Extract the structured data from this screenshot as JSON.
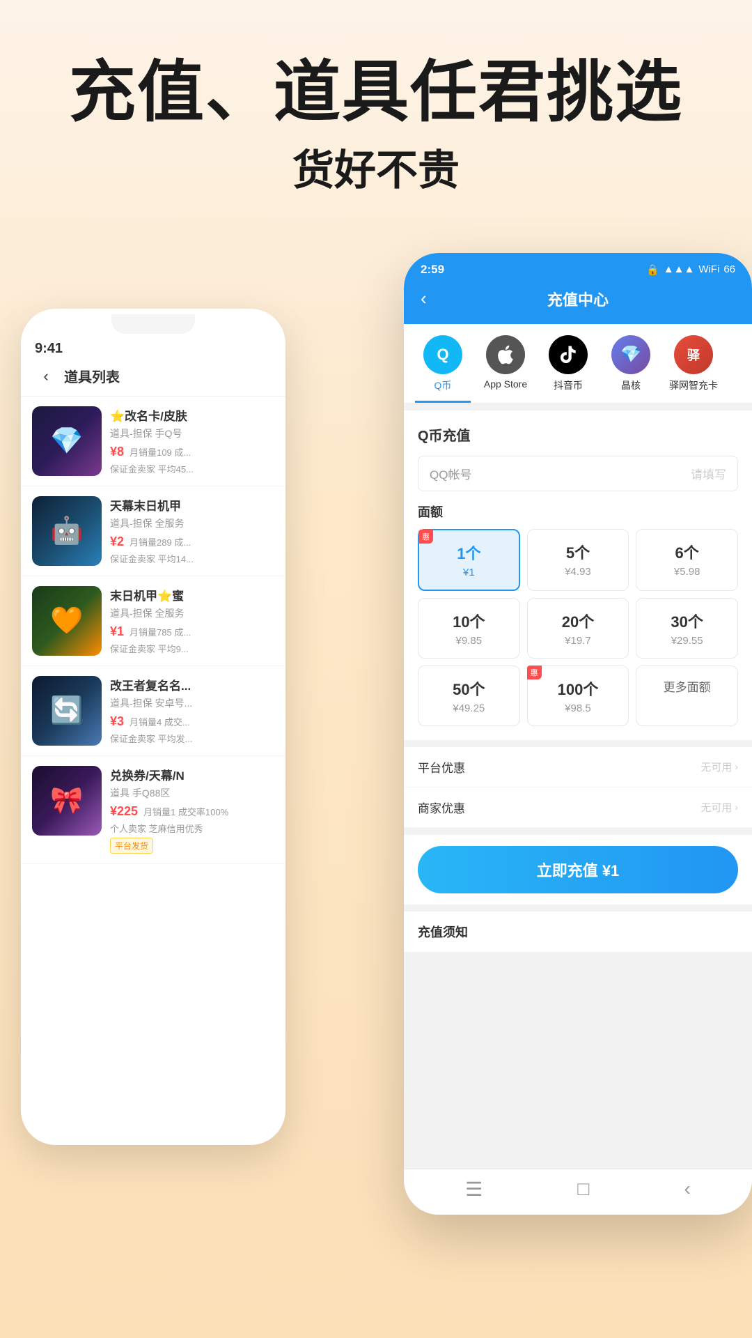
{
  "hero": {
    "title": "充值、道具任君挑选",
    "subtitle": "货好不贵"
  },
  "left_phone": {
    "time": "9:41",
    "back_label": "‹",
    "page_title": "道具列表",
    "items": [
      {
        "id": 1,
        "name": "⭐改名卡/皮肤",
        "desc": "道具-担保 手Q号",
        "price": "¥8",
        "sales": "月销量109 成...",
        "guarantee": "保证金卖家 平均45...",
        "img_class": "img-item1",
        "icon": "💎"
      },
      {
        "id": 2,
        "name": "天幕末日机甲",
        "desc": "道具-担保 全服务",
        "price": "¥2",
        "sales": "月销量289 成...",
        "guarantee": "保证金卖家 平均14...",
        "img_class": "img-item2",
        "icon": "🤖"
      },
      {
        "id": 3,
        "name": "末日机甲⭐蜜",
        "desc": "道具-担保 全服务",
        "price": "¥1",
        "sales": "月销量785 成...",
        "guarantee": "保证金卖家 平均9...",
        "img_class": "img-item3",
        "icon": "🧡"
      },
      {
        "id": 4,
        "name": "改王者复名名...",
        "desc": "道具-担保 安卓号...",
        "price": "¥3",
        "sales": "月销量4 成交...",
        "guarantee": "保证金卖家 平均发...",
        "img_class": "img-item4",
        "icon": "🔄"
      },
      {
        "id": 5,
        "name": "兑换券/天幕/N",
        "desc": "道具 手Q88区",
        "price": "¥225",
        "sales": "月销量1 成交率100%",
        "guarantee": "个人卖家 芝麻信用优秀",
        "img_class": "img-item5",
        "icon": "🎀",
        "tag": "平台发货"
      }
    ]
  },
  "right_phone": {
    "time": "2:59",
    "back_label": "‹",
    "page_title": "充值中心",
    "categories": [
      {
        "id": "qq",
        "label": "Q币",
        "icon": "Q",
        "bg": "qq",
        "active": true
      },
      {
        "id": "appstore",
        "label": "App Store",
        "icon": "",
        "bg": "apple",
        "active": false
      },
      {
        "id": "tiktok",
        "label": "抖音币",
        "icon": "♪",
        "bg": "tiktok",
        "active": false
      },
      {
        "id": "crystal",
        "label": "晶核",
        "icon": "✦",
        "bg": "crystal",
        "active": false
      },
      {
        "id": "junka",
        "label": "驿网智充卡",
        "icon": "驿",
        "bg": "junka",
        "active": false
      }
    ],
    "recharge_title": "Q币充值",
    "qq_account_label": "QQ帐号",
    "qq_account_placeholder": "请填写",
    "denom_title": "面额",
    "denominations": [
      {
        "count": "1个",
        "price": "¥1",
        "selected": true,
        "hui": true
      },
      {
        "count": "5个",
        "price": "¥4.93",
        "selected": false,
        "hui": false
      },
      {
        "count": "6个",
        "price": "¥5.98",
        "selected": false,
        "hui": false
      },
      {
        "count": "10个",
        "price": "¥9.85",
        "selected": false,
        "hui": false
      },
      {
        "count": "20个",
        "price": "¥19.7",
        "selected": false,
        "hui": false
      },
      {
        "count": "30个",
        "price": "¥29.55",
        "selected": false,
        "hui": false
      },
      {
        "count": "50个",
        "price": "¥49.25",
        "selected": false,
        "hui": false
      },
      {
        "count": "100个",
        "price": "¥98.5",
        "selected": false,
        "hui": true
      },
      {
        "count": "more",
        "price": "",
        "selected": false,
        "hui": false
      }
    ],
    "platform_discount_label": "平台优惠",
    "platform_discount_value": "无可用",
    "merchant_discount_label": "商家优惠",
    "merchant_discount_value": "无可用",
    "recharge_btn_label": "立即充值 ¥1",
    "notice_title": "充值须知"
  }
}
